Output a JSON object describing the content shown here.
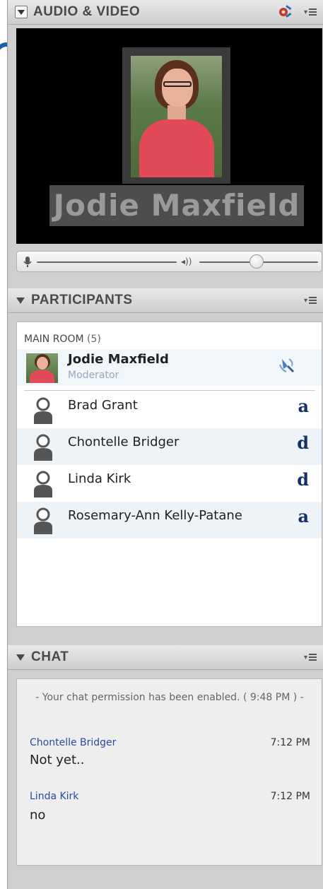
{
  "audio_video": {
    "title": "AUDIO & VIDEO",
    "speaker_name": "Jodie Maxfield",
    "volume_level_fraction": 0.55,
    "icons": [
      "collapse-icon",
      "settings-icon",
      "panel-menu-icon",
      "microphone-icon",
      "speaker-icon"
    ]
  },
  "participants": {
    "title": "PARTICIPANTS",
    "room": {
      "label": "MAIN ROOM",
      "count": "(5)"
    },
    "moderator": {
      "name": "Jodie Maxfield",
      "role": "Moderator"
    },
    "list": [
      {
        "name": "Brad Grant",
        "status": "a"
      },
      {
        "name": "Chontelle Bridger",
        "status": "d"
      },
      {
        "name": "Linda Kirk",
        "status": "d"
      },
      {
        "name": "Rosemary-Ann Kelly-Patane",
        "status": "a"
      }
    ]
  },
  "chat": {
    "title": "CHAT",
    "system_message": "- Your chat permission has been enabled. ( 9:48 PM ) -",
    "messages": [
      {
        "sender": "Chontelle Bridger",
        "time": "7:12 PM",
        "text": "Not yet.."
      },
      {
        "sender": "Linda Kirk",
        "time": "7:12 PM",
        "text": "no"
      }
    ]
  },
  "colors": {
    "accent_blue": "#14306a",
    "sender_blue": "#2a4aa0",
    "participant_highlight": "#eef3f8"
  }
}
